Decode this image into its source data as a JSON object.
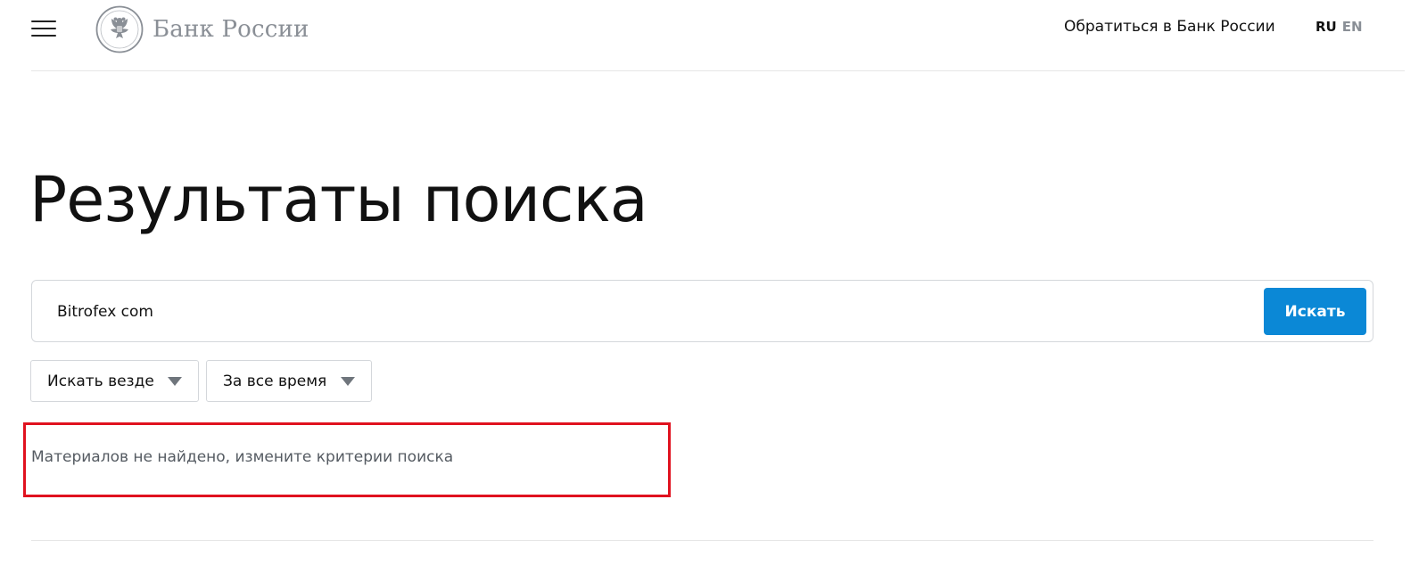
{
  "header": {
    "logo_text": "Банк России",
    "contact_link": "Обратиться в Банк России",
    "lang_ru": "RU",
    "lang_en": "EN"
  },
  "page": {
    "title": "Результаты поиска"
  },
  "search": {
    "value": "Bitrofex com",
    "button_label": "Искать"
  },
  "filters": {
    "scope": "Искать везде",
    "period": "За все время"
  },
  "results": {
    "message": "Материалов не найдено, измените критерии поиска"
  },
  "colors": {
    "accent": "#0b88d6",
    "highlight": "#e0121f"
  }
}
